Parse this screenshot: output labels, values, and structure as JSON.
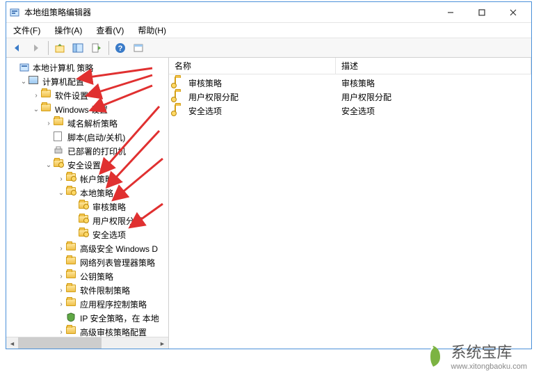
{
  "window": {
    "title": "本地组策略编辑器"
  },
  "menu": {
    "file": "文件(F)",
    "action": "操作(A)",
    "view": "查看(V)",
    "help": "帮助(H)"
  },
  "tree": {
    "root": "本地计算机 策略",
    "computer_config": "计算机配置",
    "software_settings": "软件设置",
    "windows_settings": "Windows 设置",
    "dns_policy": "域名解析策略",
    "scripts": "脚本(启动/关机)",
    "deployed_printers": "已部署的打印机",
    "security_settings": "安全设置",
    "account_policies": "帐户策略",
    "local_policies": "本地策略",
    "audit_policy": "审核策略",
    "user_rights": "用户权限分配",
    "security_options": "安全选项",
    "advanced_windows": "高级安全 Windows D",
    "network_list": "网络列表管理器策略",
    "public_key": "公钥策略",
    "software_restrict": "软件限制策略",
    "app_control": "应用程序控制策略",
    "ip_security": "IP 安全策略，在 本地",
    "advanced_audit": "高级审核策略配置"
  },
  "list": {
    "col_name": "名称",
    "col_desc": "描述",
    "rows": [
      {
        "name": "审核策略",
        "desc": "审核策略"
      },
      {
        "name": "用户权限分配",
        "desc": "用户权限分配"
      },
      {
        "name": "安全选项",
        "desc": "安全选项"
      }
    ]
  },
  "watermark": {
    "name": "系统宝库",
    "url": "www.xitongbaoku.com"
  }
}
